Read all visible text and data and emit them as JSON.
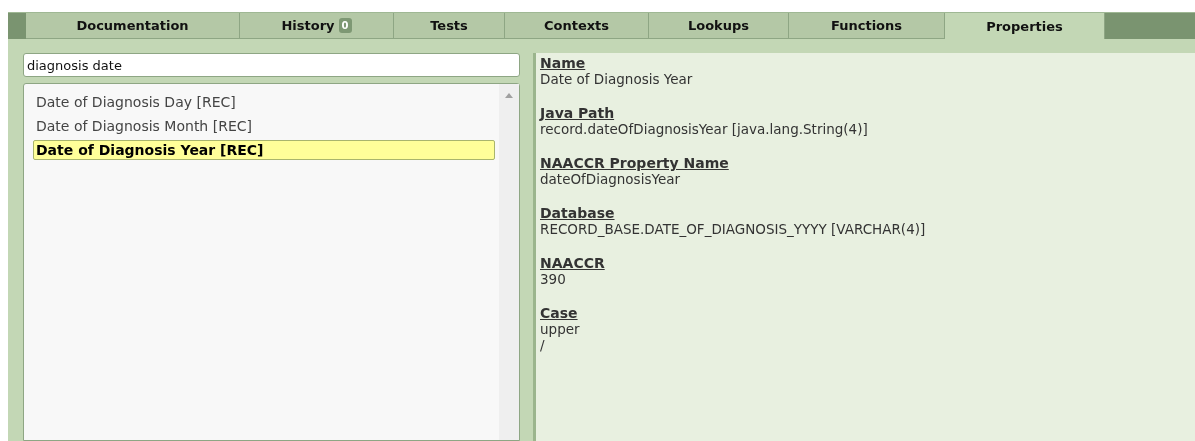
{
  "tabs": [
    {
      "label": "Documentation",
      "selected": false
    },
    {
      "label": "History",
      "badge": "0",
      "selected": false
    },
    {
      "label": "Tests",
      "selected": false
    },
    {
      "label": "Contexts",
      "selected": false
    },
    {
      "label": "Lookups",
      "selected": false
    },
    {
      "label": "Functions",
      "selected": false
    },
    {
      "label": "Properties",
      "selected": true
    }
  ],
  "search": {
    "value": "diagnosis date"
  },
  "results": [
    {
      "label": "Date of Diagnosis Day [REC]",
      "selected": false
    },
    {
      "label": "Date of Diagnosis Month [REC]",
      "selected": false
    },
    {
      "label": "Date of Diagnosis Year [REC]",
      "selected": true
    }
  ],
  "properties": [
    {
      "name": "Name",
      "values": [
        "Date of Diagnosis Year"
      ]
    },
    {
      "name": "Java Path",
      "values": [
        "record.dateOfDiagnosisYear [java.lang.String(4)]"
      ]
    },
    {
      "name": "NAACCR Property Name",
      "values": [
        "dateOfDiagnosisYear"
      ]
    },
    {
      "name": "Database",
      "values": [
        "RECORD_BASE.DATE_OF_DIAGNOSIS_YYYY [VARCHAR(4)]"
      ]
    },
    {
      "name": "NAACCR",
      "values": [
        "390"
      ]
    },
    {
      "name": "Case",
      "values": [
        "upper",
        "/"
      ]
    }
  ]
}
